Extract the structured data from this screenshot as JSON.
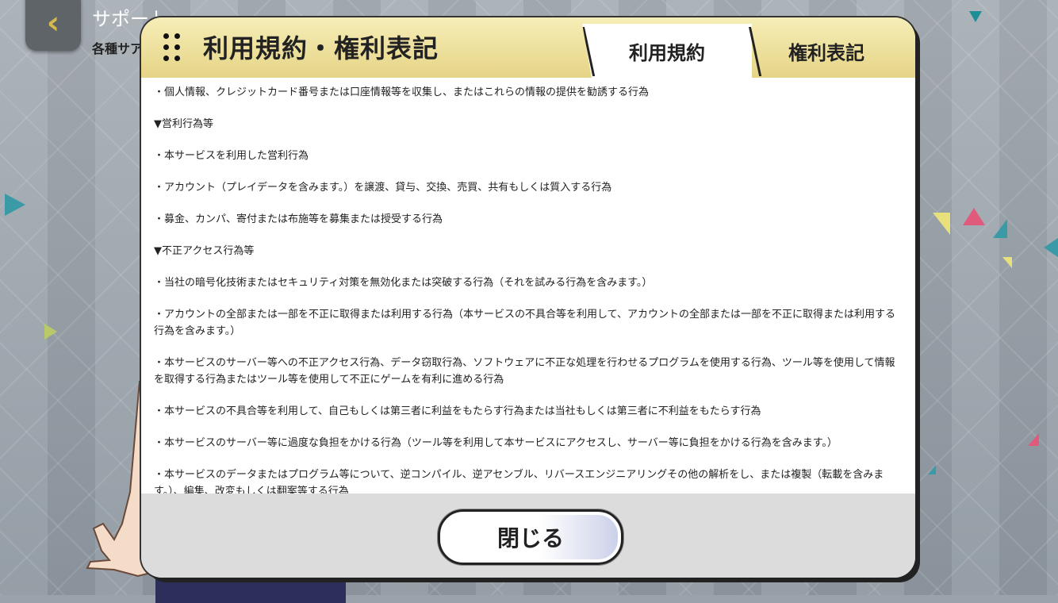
{
  "page": {
    "title": "サポート",
    "subtitle": "各種サア"
  },
  "dialog": {
    "title": "利用規約・権利表記",
    "tabs": [
      {
        "label": "利用規約",
        "active": true
      },
      {
        "label": "権利表記",
        "active": false
      }
    ],
    "paragraphs": [
      "・個人情報、クレジットカード番号または口座情報等を収集し、またはこれらの情報の提供を勧誘する行為",
      "▼営利行為等",
      "・本サービスを利用した営利行為",
      "・アカウント（プレイデータを含みます。）を譲渡、貸与、交換、売買、共有もしくは質入する行為",
      "・募金、カンパ、寄付または布施等を募集または授受する行為",
      "▼不正アクセス行為等",
      "・当社の暗号化技術またはセキュリティ対策を無効化または突破する行為（それを試みる行為を含みます。）",
      "・アカウントの全部または一部を不正に取得または利用する行為（本サービスの不具合等を利用して、アカウントの全部または一部を不正に取得または利用する行為を含みます。）",
      "・本サービスのサーバー等への不正アクセス行為、データ窃取行為、ソフトウェアに不正な処理を行わせるプログラムを使用する行為、ツール等を使用して情報を取得する行為またはツール等を使用して不正にゲームを有利に進める行為",
      "・本サービスの不具合等を利用して、自己もしくは第三者に利益をもたらす行為または当社もしくは第三者に不利益をもたらす行為",
      "・本サービスのサーバー等に過度な負担をかける行為（ツール等を利用して本サービスにアクセスし、サーバー等に負担をかける行為を含みます。）",
      "・本サービスのデータまたはプログラム等について、逆コンパイル、逆アセンブル、リバースエンジニアリングその他の解析をし、または複製（転載を含みます。）、編集、改変もしくは翻案等する行為"
    ],
    "close_label": "閉じる"
  },
  "icons": {
    "back": "chevron-left-icon",
    "grip": "drag-handle-icon"
  },
  "colors": {
    "header_gold": "#e6d486",
    "back_chevron": "#d7b94d"
  }
}
